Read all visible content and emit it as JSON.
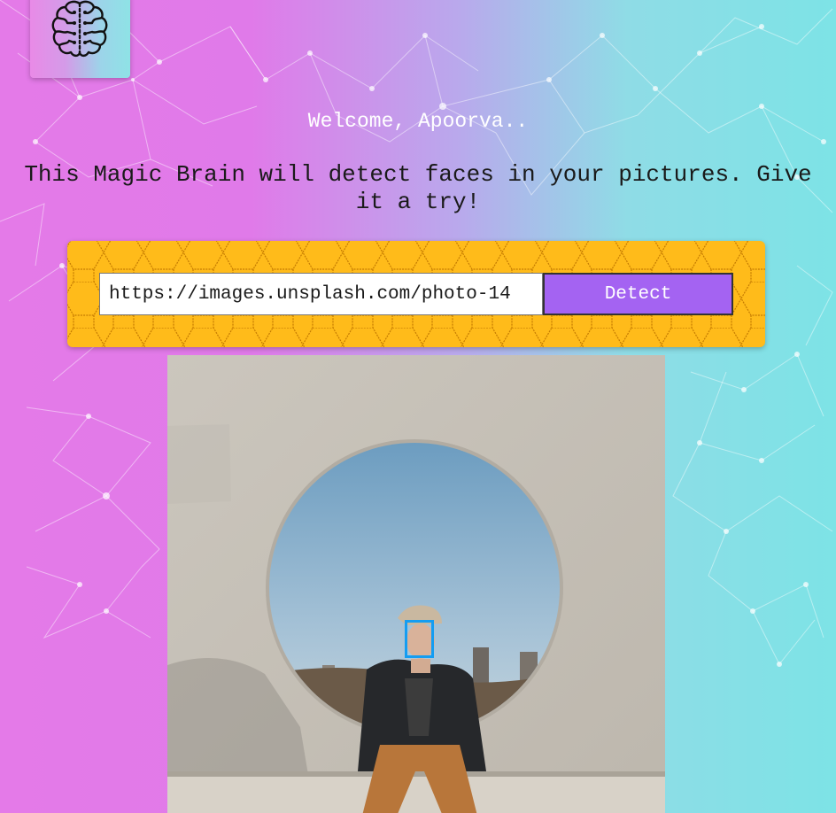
{
  "app": {
    "logo_icon": "brain-icon"
  },
  "header": {
    "welcome": "Welcome, Apoorva..",
    "tagline": "This Magic Brain will detect faces in your pictures. Give it a try!"
  },
  "form": {
    "url_value": "https://images.unsplash.com/photo-14",
    "detect_label": "Detect"
  },
  "colors": {
    "panel": "#ffbb1a",
    "button": "#a463f2",
    "face_box": "#149df2"
  }
}
